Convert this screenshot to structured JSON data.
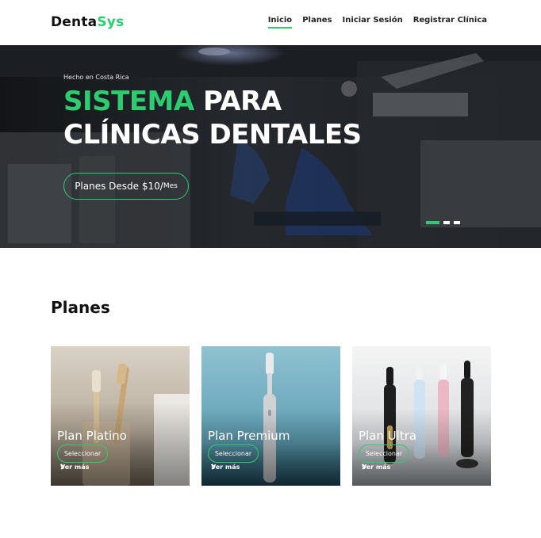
{
  "brand": {
    "part1": "Denta",
    "part2": "Sys"
  },
  "nav": {
    "items": [
      {
        "label": "Inicio",
        "active": true
      },
      {
        "label": "Planes"
      },
      {
        "label": "Iniciar Sesión"
      },
      {
        "label": "Registrar Clínica"
      }
    ]
  },
  "hero": {
    "tagline": "Hecho en Costa Rica",
    "title_accent": "SISTEMA",
    "title_rest": " PARA",
    "title_line2": "CLÍNICAS DENTALES",
    "button_main": "Planes Desde $10/",
    "button_small": "Mes",
    "slides_total": 3,
    "slide_active": 1
  },
  "plans": {
    "title": "Planes",
    "cards": [
      {
        "name": "Plan Platino",
        "button": "Seleccionar",
        "more": "Ver más"
      },
      {
        "name": "Plan Premium",
        "button": "Seleccionar",
        "more": "Ver más"
      },
      {
        "name": "Plan Ultra",
        "button": "Seleccionar",
        "more": "Ver más"
      }
    ]
  },
  "colors": {
    "accent": "#2ecc71",
    "text": "#111111"
  }
}
